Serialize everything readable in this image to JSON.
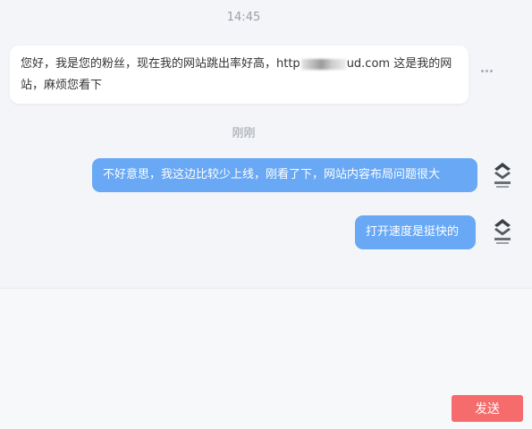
{
  "chat": {
    "timestamps": [
      "14:45",
      "刚刚"
    ],
    "incoming": {
      "text_before_link": "您好，我是您的粉丝，现在我的网站跳出率好高，http",
      "text_after_link": "ud.com 这是我的网站，麻烦您看下"
    },
    "outgoing": [
      "不好意思，我这边比较少上线，刚看了下，网站内容布局问题很大",
      "打开速度是挺快的"
    ],
    "avatar_icon": "brand-logo-icon",
    "more_icon": "more-options-icon"
  },
  "composer": {
    "input_value": "",
    "send_label": "发送"
  },
  "colors": {
    "outgoing_bubble": "#68a8f5",
    "send_button": "#f66b6b",
    "background": "#f4f5f8"
  }
}
